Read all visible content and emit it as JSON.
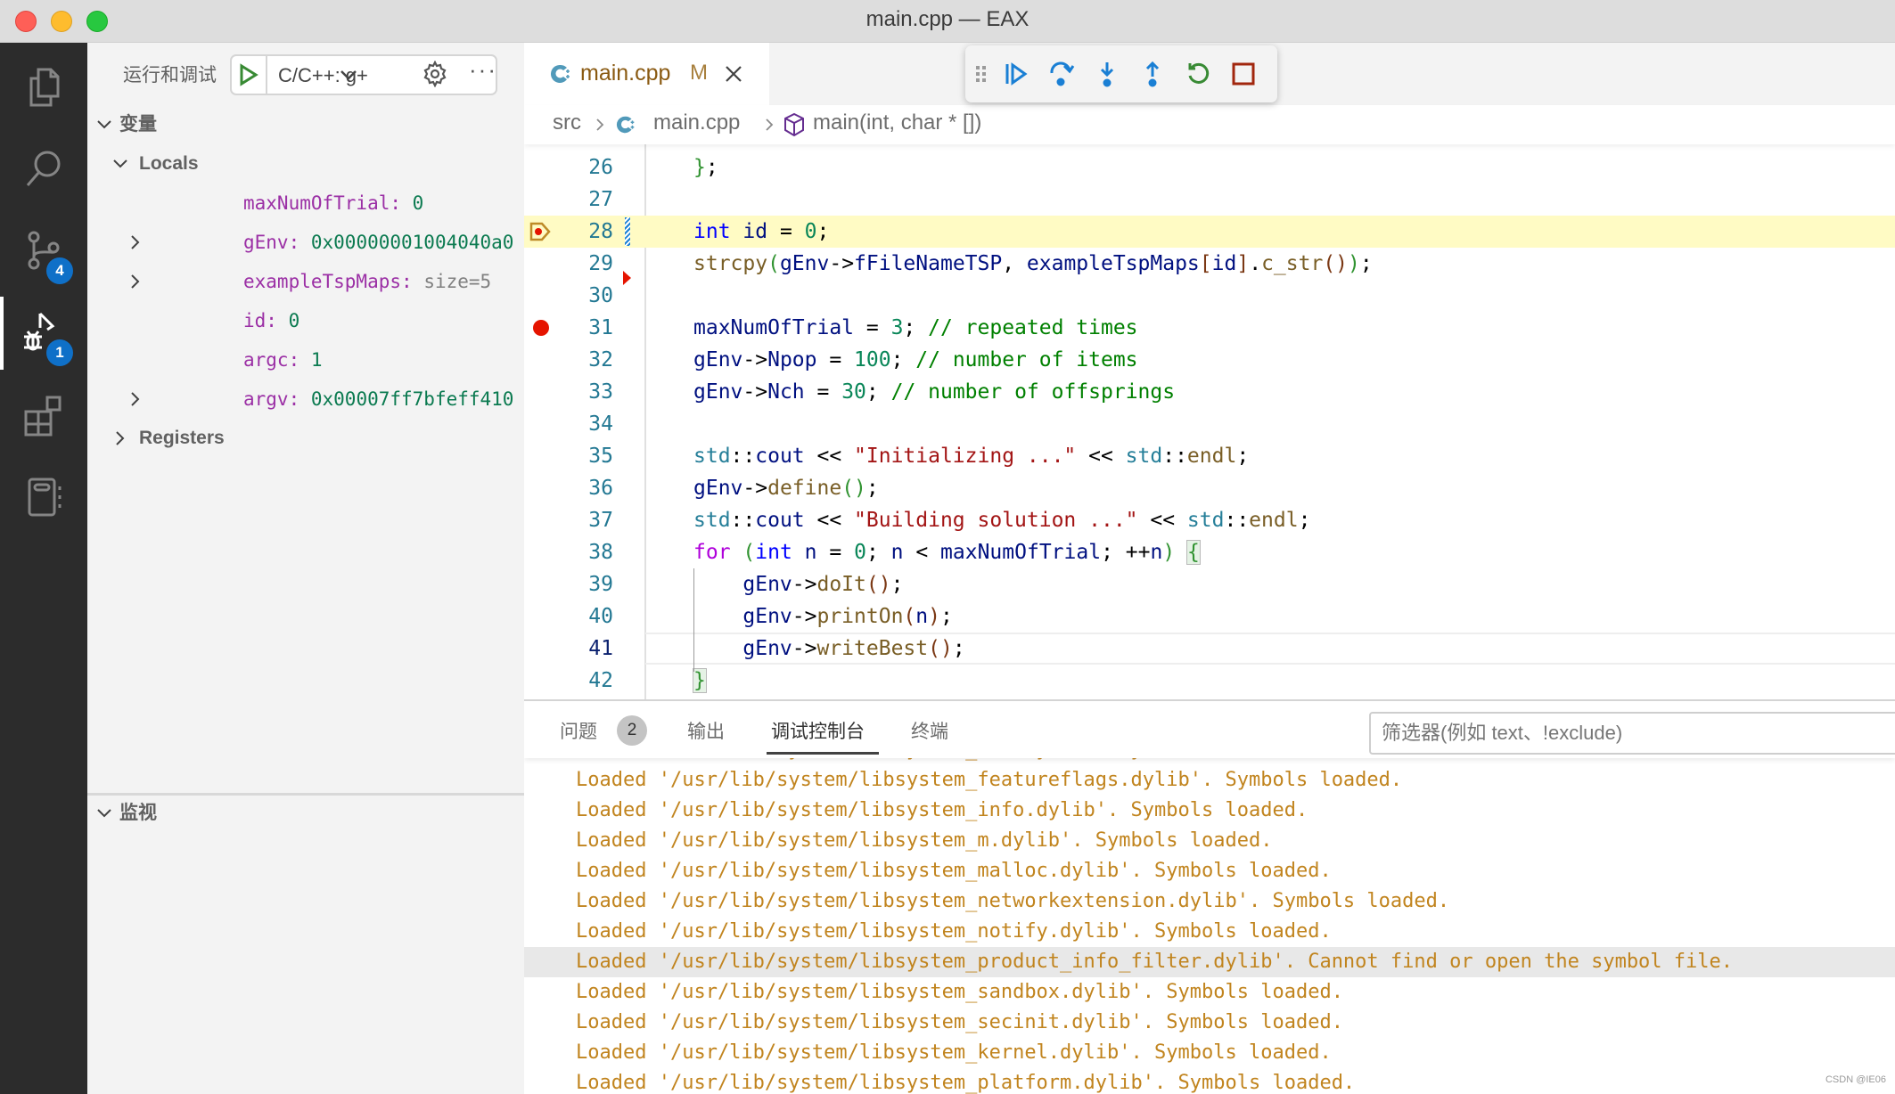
{
  "window": {
    "title": "main.cpp — EAX"
  },
  "activity_bar": {
    "items": [
      {
        "name": "explorer",
        "icon": "files-icon"
      },
      {
        "name": "search",
        "icon": "search-icon"
      },
      {
        "name": "source-control",
        "icon": "source-control-icon",
        "badge": "4"
      },
      {
        "name": "run-and-debug",
        "icon": "debug-icon",
        "badge": "1",
        "active": true
      },
      {
        "name": "extensions",
        "icon": "extensions-icon"
      },
      {
        "name": "notebook",
        "icon": "notebook-icon"
      }
    ]
  },
  "sidebar": {
    "title": "运行和调试",
    "launch_config": "C/C++: g++",
    "variables_header": "变量",
    "locals_header": "Locals",
    "variables": [
      {
        "name": "maxNumOfTrial",
        "value": "0",
        "expandable": false
      },
      {
        "name": "gEnv",
        "value": "0x00000001004040a0",
        "expandable": true
      },
      {
        "name": "exampleTspMaps",
        "value": "size=5",
        "expandable": true,
        "value_style": "gray"
      },
      {
        "name": "id",
        "value": "0",
        "expandable": false
      },
      {
        "name": "argc",
        "value": "1",
        "expandable": false
      },
      {
        "name": "argv",
        "value": "0x00007ff7bfeff410",
        "expandable": true
      }
    ],
    "registers_header": "Registers",
    "watch_header": "监视"
  },
  "editor": {
    "tab": {
      "label": "main.cpp",
      "modified_marker": "M"
    },
    "breadcrumb": [
      "src",
      "main.cpp",
      "main(int, char * [])"
    ],
    "debug_toolbar": [
      "continue",
      "step-over",
      "step-into",
      "step-out",
      "restart",
      "stop"
    ],
    "current_line": 28,
    "cursor_line": 41,
    "breakpoint_lines": [
      28,
      31
    ],
    "lines": [
      {
        "n": "26",
        "tokens": [
          [
            "p1",
            "}"
          ],
          [
            "op",
            ";"
          ]
        ]
      },
      {
        "n": "27",
        "tokens": []
      },
      {
        "n": "28",
        "tokens": [
          [
            "kw",
            "int"
          ],
          [
            "op",
            " "
          ],
          [
            "var",
            "id"
          ],
          [
            "op",
            " = "
          ],
          [
            "num",
            "0"
          ],
          [
            "op",
            ";"
          ]
        ]
      },
      {
        "n": "29",
        "tokens": [
          [
            "fn",
            "strcpy"
          ],
          [
            "p1",
            "("
          ],
          [
            "var",
            "gEnv"
          ],
          [
            "op",
            "->"
          ],
          [
            "var",
            "fFileNameTSP"
          ],
          [
            "op",
            ", "
          ],
          [
            "var",
            "exampleTspMaps"
          ],
          [
            "p2",
            "["
          ],
          [
            "var",
            "id"
          ],
          [
            "p2",
            "]"
          ],
          [
            "op",
            "."
          ],
          [
            "fn",
            "c_str"
          ],
          [
            "p2",
            "()"
          ],
          [
            "p1",
            ")"
          ],
          [
            "op",
            ";"
          ]
        ]
      },
      {
        "n": "30",
        "tokens": []
      },
      {
        "n": "31",
        "tokens": [
          [
            "var",
            "maxNumOfTrial"
          ],
          [
            "op",
            " = "
          ],
          [
            "num",
            "3"
          ],
          [
            "op",
            "; "
          ],
          [
            "com",
            "// repeated times"
          ]
        ]
      },
      {
        "n": "32",
        "tokens": [
          [
            "var",
            "gEnv"
          ],
          [
            "op",
            "->"
          ],
          [
            "var",
            "Npop"
          ],
          [
            "op",
            " = "
          ],
          [
            "num",
            "100"
          ],
          [
            "op",
            "; "
          ],
          [
            "com",
            "// number of items"
          ]
        ]
      },
      {
        "n": "33",
        "tokens": [
          [
            "var",
            "gEnv"
          ],
          [
            "op",
            "->"
          ],
          [
            "var",
            "Nch"
          ],
          [
            "op",
            " = "
          ],
          [
            "num",
            "30"
          ],
          [
            "op",
            "; "
          ],
          [
            "com",
            "// number of offsprings"
          ]
        ]
      },
      {
        "n": "34",
        "tokens": []
      },
      {
        "n": "35",
        "tokens": [
          [
            "ns",
            "std"
          ],
          [
            "op",
            "::"
          ],
          [
            "var",
            "cout"
          ],
          [
            "op",
            " << "
          ],
          [
            "str",
            "\"Initializing ...\""
          ],
          [
            "op",
            " << "
          ],
          [
            "ns",
            "std"
          ],
          [
            "op",
            "::"
          ],
          [
            "fn",
            "endl"
          ],
          [
            "op",
            ";"
          ]
        ]
      },
      {
        "n": "36",
        "tokens": [
          [
            "var",
            "gEnv"
          ],
          [
            "op",
            "->"
          ],
          [
            "fn",
            "define"
          ],
          [
            "p1",
            "()"
          ],
          [
            "op",
            ";"
          ]
        ]
      },
      {
        "n": "37",
        "tokens": [
          [
            "ns",
            "std"
          ],
          [
            "op",
            "::"
          ],
          [
            "var",
            "cout"
          ],
          [
            "op",
            " << "
          ],
          [
            "str",
            "\"Building solution ...\""
          ],
          [
            "op",
            " << "
          ],
          [
            "ns",
            "std"
          ],
          [
            "op",
            "::"
          ],
          [
            "fn",
            "endl"
          ],
          [
            "op",
            ";"
          ]
        ]
      },
      {
        "n": "38",
        "tokens": [
          [
            "ctl",
            "for"
          ],
          [
            "op",
            " "
          ],
          [
            "p1",
            "("
          ],
          [
            "kw",
            "int"
          ],
          [
            "op",
            " "
          ],
          [
            "var",
            "n"
          ],
          [
            "op",
            " = "
          ],
          [
            "num",
            "0"
          ],
          [
            "op",
            "; "
          ],
          [
            "var",
            "n"
          ],
          [
            "op",
            " < "
          ],
          [
            "var",
            "maxNumOfTrial"
          ],
          [
            "op",
            "; ++"
          ],
          [
            "var",
            "n"
          ],
          [
            "p1",
            ")"
          ],
          [
            "op",
            " "
          ],
          [
            "bm",
            "{"
          ]
        ]
      },
      {
        "n": "39",
        "tokens": [
          [
            "op",
            "    "
          ],
          [
            "var",
            "gEnv"
          ],
          [
            "op",
            "->"
          ],
          [
            "fn",
            "doIt"
          ],
          [
            "p2",
            "()"
          ],
          [
            "op",
            ";"
          ]
        ]
      },
      {
        "n": "40",
        "tokens": [
          [
            "op",
            "    "
          ],
          [
            "var",
            "gEnv"
          ],
          [
            "op",
            "->"
          ],
          [
            "fn",
            "printOn"
          ],
          [
            "p2",
            "("
          ],
          [
            "var",
            "n"
          ],
          [
            "p2",
            ")"
          ],
          [
            "op",
            ";"
          ]
        ]
      },
      {
        "n": "41",
        "tokens": [
          [
            "op",
            "    "
          ],
          [
            "var",
            "gEnv"
          ],
          [
            "op",
            "->"
          ],
          [
            "fn",
            "writeBest"
          ],
          [
            "p2",
            "()"
          ],
          [
            "op",
            ";"
          ]
        ]
      },
      {
        "n": "42",
        "tokens": [
          [
            "bm",
            "}"
          ]
        ]
      }
    ]
  },
  "panel": {
    "tabs": [
      {
        "label": "问题",
        "badge": "2"
      },
      {
        "label": "输出"
      },
      {
        "label": "调试控制台",
        "active": true
      },
      {
        "label": "终端"
      }
    ],
    "filter_placeholder": "筛选器(例如 text、!exclude)",
    "console_lines": [
      "Loaded '/usr/lib/system/libsystem_asl.dylib'. Symbols loaded.",
      "Loaded '/usr/lib/system/libsystem_featureflags.dylib'. Symbols loaded.",
      "Loaded '/usr/lib/system/libsystem_info.dylib'. Symbols loaded.",
      "Loaded '/usr/lib/system/libsystem_m.dylib'. Symbols loaded.",
      "Loaded '/usr/lib/system/libsystem_malloc.dylib'. Symbols loaded.",
      "Loaded '/usr/lib/system/libsystem_networkextension.dylib'. Symbols loaded.",
      "Loaded '/usr/lib/system/libsystem_notify.dylib'. Symbols loaded.",
      "Loaded '/usr/lib/system/libsystem_product_info_filter.dylib'. Cannot find or open the symbol file.",
      "Loaded '/usr/lib/system/libsystem_sandbox.dylib'. Symbols loaded.",
      "Loaded '/usr/lib/system/libsystem_secinit.dylib'. Symbols loaded.",
      "Loaded '/usr/lib/system/libsystem_kernel.dylib'. Symbols loaded.",
      "Loaded '/usr/lib/system/libsystem_platform.dylib'. Symbols loaded."
    ],
    "selected_line_index": 7
  },
  "watermark": "CSDN @IE06",
  "colors": {
    "activity_bar_bg": "#2c2c2c",
    "sidebar_bg": "#f3f3f3",
    "current_line_bg": "#fffbc4",
    "breakpoint": "#e51400",
    "badge": "#0f70c8",
    "console_text": "#c1841e",
    "debug_blue": "#1a7fd4",
    "debug_green": "#388a34",
    "debug_red": "#a1260d"
  }
}
